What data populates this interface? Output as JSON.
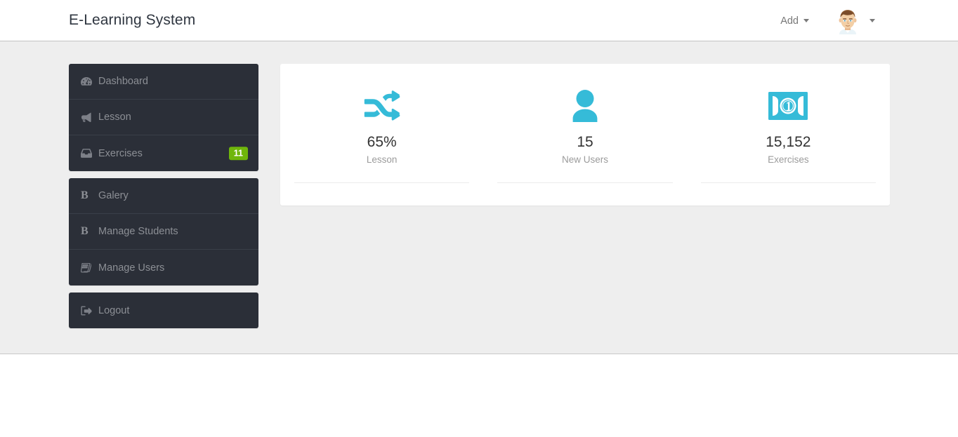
{
  "header": {
    "brand": "E-Learning System",
    "add_label": "Add",
    "add_caret_icon": "caret-down-icon",
    "user_caret_icon": "caret-down-icon",
    "avatar_icon": "user-avatar"
  },
  "sidebar": {
    "groups": [
      {
        "items": [
          {
            "label": "Dashboard",
            "icon": "dashboard-icon",
            "badge": null
          },
          {
            "label": "Lesson",
            "icon": "bullhorn-icon",
            "badge": null
          },
          {
            "label": "Exercises",
            "icon": "inbox-icon",
            "badge": "11"
          }
        ]
      },
      {
        "items": [
          {
            "label": "Galery",
            "icon": "missing-glyph-icon",
            "badge": null
          },
          {
            "label": "Manage Students",
            "icon": "missing-glyph-icon",
            "badge": null
          },
          {
            "label": "Manage Users",
            "icon": "book-icon",
            "badge": null
          }
        ]
      },
      {
        "items": [
          {
            "label": "Logout",
            "icon": "sign-out-icon",
            "badge": null
          }
        ]
      }
    ],
    "missing_glyph_char": "B"
  },
  "main": {
    "stats": [
      {
        "icon": "shuffle-icon",
        "value": "65%",
        "label": "Lesson"
      },
      {
        "icon": "user-icon",
        "value": "15",
        "label": "New Users"
      },
      {
        "icon": "money-bill-icon",
        "value": "15,152",
        "label": "Exercises"
      }
    ]
  },
  "colors": {
    "accent_cyan": "#35bbd8",
    "badge_green": "#6fb60b",
    "sidebar_dark": "#2b2f38",
    "content_bg": "#eeeeee",
    "brand_text": "#2f3640"
  }
}
